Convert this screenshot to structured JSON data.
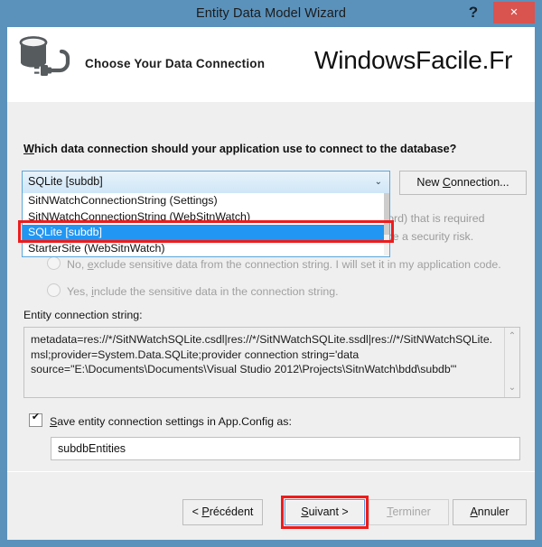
{
  "window": {
    "title": "Entity Data Model Wizard",
    "help_label": "?",
    "close_label": "×",
    "accent_color": "#5b92bc",
    "close_color": "#d9534f"
  },
  "header": {
    "icon": "database-connection-icon",
    "subtitle": "Choose Your Data Connection",
    "brand": "WindowsFacile.Fr"
  },
  "body": {
    "question_prefix": "W",
    "question_rest": "hich data connection should your application use to connect to the database?",
    "combo": {
      "selected_value": "SQLite [subdb]",
      "arrow": "⌄",
      "expanded": true,
      "options": [
        "SitNWatchConnectionString (Settings)",
        "SitNWatchConnectionString (WebSitnWatch)",
        "SQLite [subdb]",
        "StarterSite (WebSitnWatch)"
      ],
      "selected_index": 2,
      "highlight_color": "#2196f3"
    },
    "new_connection": {
      "prefix": "New ",
      "accel": "C",
      "suffix": "onnection..."
    },
    "obscured_text": {
      "line1": "password) that is required",
      "line2": "g can be a security risk."
    },
    "radios": [
      {
        "prefix": "No, ",
        "accel": "e",
        "suffix": "xclude sensitive data from the connection string. I will set it in my application code.",
        "checked": false,
        "disabled": true
      },
      {
        "prefix": "Yes, ",
        "accel": "i",
        "suffix": "nclude the sensitive data in the connection string.",
        "checked": false,
        "disabled": true
      }
    ],
    "entity_connection_string": {
      "label": "Entity connection string:",
      "value": "metadata=res://*/SitNWatchSQLite.csdl|res://*/SitNWatchSQLite.ssdl|res://*/SitNWatchSQLite.msl;provider=System.Data.SQLite;provider connection string='data source=\"E:\\Documents\\Documents\\Visual Studio 2012\\Projects\\SitnWatch\\bdd\\subdb\"'",
      "scroll_up": "⌃",
      "scroll_down": "⌄"
    },
    "save_setting": {
      "checked": true,
      "prefix": "S",
      "rest": "ave entity connection settings in App.Config as:",
      "value": "subdbEntities"
    }
  },
  "footer": {
    "buttons": [
      {
        "prefix": "< ",
        "accel": "P",
        "suffix": "récédent",
        "disabled": false,
        "focused": false
      },
      {
        "prefix": "",
        "accel": "S",
        "suffix": "uivant >",
        "disabled": false,
        "focused": true
      },
      {
        "prefix": "",
        "accel": "T",
        "suffix": "erminer",
        "disabled": true,
        "focused": false
      },
      {
        "prefix": "",
        "accel": "A",
        "suffix": "nnuler",
        "disabled": false,
        "focused": false
      }
    ]
  },
  "annotations": {
    "highlight_color": "#ee1c1c",
    "boxes": [
      "selected-combo-item",
      "suivant-button"
    ]
  }
}
